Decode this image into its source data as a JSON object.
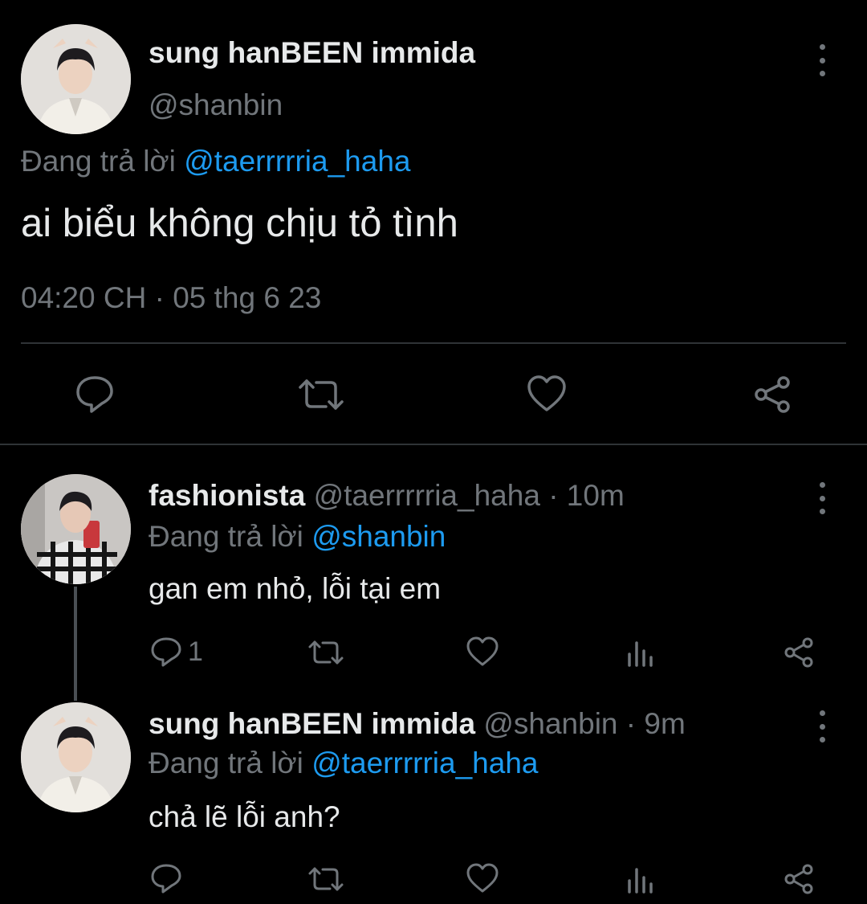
{
  "main_tweet": {
    "display_name": "sung hanBEEN immida",
    "handle": "@shanbin",
    "replying_prefix": "Đang trả lời",
    "replying_to": "@taerrrrria_haha",
    "text": "ai biểu không chịu tỏ tình",
    "time": "04:20 CH",
    "separator": "·",
    "date": "05 thg 6 23"
  },
  "replies": [
    {
      "display_name": "fashionista",
      "handle": "@taerrrrria_haha",
      "separator": "·",
      "age": "10m",
      "replying_prefix": "Đang trả lời",
      "replying_to": "@shanbin",
      "text": "gan em nhỏ, lỗi tại em",
      "reply_count": "1"
    },
    {
      "display_name": "sung hanBEEN immida",
      "handle": "@shanbin",
      "separator": "·",
      "age": "9m",
      "replying_prefix": "Đang trả lời",
      "replying_to": "@taerrrrria_haha",
      "text": "chả lẽ lỗi anh?",
      "reply_count": ""
    }
  ],
  "colors": {
    "background": "#000000",
    "text": "#e7e9ea",
    "muted": "#71767b",
    "link": "#1d9bf0",
    "divider": "#2f3336"
  },
  "icons": [
    "more-vertical-icon",
    "reply-icon",
    "retweet-icon",
    "like-icon",
    "views-icon",
    "share-icon"
  ]
}
